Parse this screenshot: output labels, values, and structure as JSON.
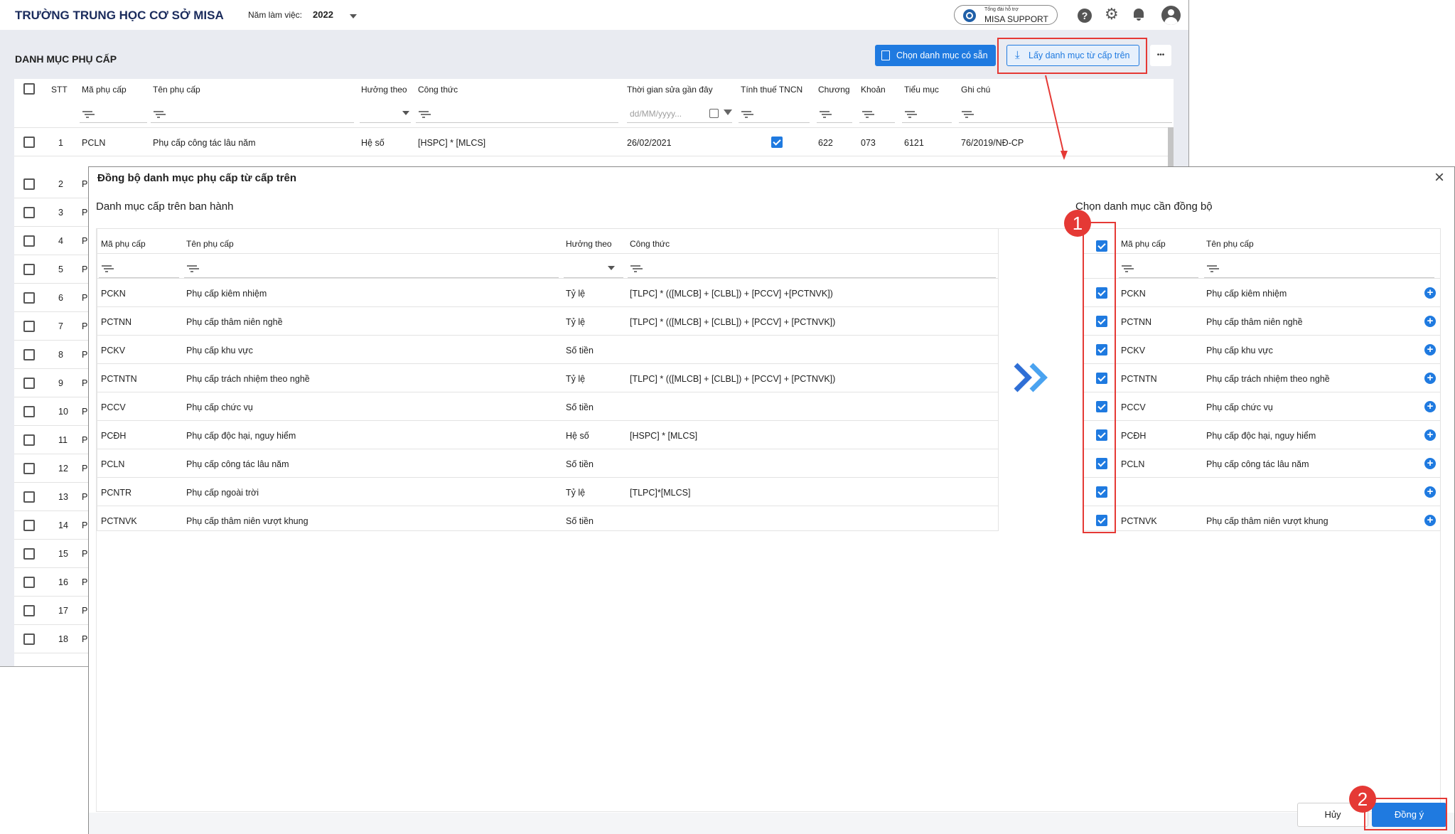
{
  "app": {
    "school_name": "TRƯỜNG TRUNG HỌC CƠ SỞ MISA",
    "year_label": "Năm làm việc:",
    "year_value": "2022",
    "support_top": "Tổng đài hỗ trợ",
    "support_label": "MISA SUPPORT"
  },
  "page": {
    "title": "DANH MỤC PHỤ CẤP",
    "btn_choose": "Chọn danh mục có sẵn",
    "btn_get": "Lấy danh mục từ cấp trên",
    "more": "•••"
  },
  "grid": {
    "headers": [
      "STT",
      "Mã phụ cấp",
      "Tên phụ cấp",
      "Hưởng theo",
      "Công thức",
      "Thời gian sửa gần đây",
      "Tính thuế TNCN",
      "Chương",
      "Khoản",
      "Tiểu mục",
      "Ghi chú"
    ],
    "date_placeholder": "dd/MM/yyyy...",
    "first_row": {
      "stt": "1",
      "code": "PCLN",
      "name": "Phụ cấp công tác lâu năm",
      "by": "Hệ số",
      "formula": "[HSPC] * [MLCS]",
      "date": "26/02/2021",
      "chuong": "622",
      "khoan": "073",
      "tieumuc": "6121",
      "note": "76/2019/NĐ-CP"
    },
    "stt_rows": [
      "2",
      "3",
      "4",
      "5",
      "6",
      "7",
      "8",
      "9",
      "10",
      "11",
      "12",
      "13",
      "14",
      "15",
      "16",
      "17",
      "18"
    ],
    "code_initial": "P"
  },
  "modal": {
    "title": "Đồng bộ danh mục phụ cấp từ cấp trên",
    "left_title": "Danh mục cấp trên ban hành",
    "right_title": "Chọn danh mục cần đồng bộ",
    "left_headers": [
      "Mã phụ cấp",
      "Tên phụ cấp",
      "Hưởng theo",
      "Công thức"
    ],
    "right_headers": [
      "Mã phụ cấp",
      "Tên phụ cấp"
    ],
    "left_rows": [
      {
        "code": "PCKN",
        "name": "Phụ cấp kiêm nhiệm",
        "by": "Tỷ lệ",
        "formula": "[TLPC] * (([MLCB] + [CLBL]) + [PCCV] +[PCTNVK])"
      },
      {
        "code": "PCTNN",
        "name": "Phụ cấp thâm niên nghề",
        "by": "Tỷ lệ",
        "formula": "[TLPC] * (([MLCB] + [CLBL]) + [PCCV] + [PCTNVK])"
      },
      {
        "code": "PCKV",
        "name": "Phụ cấp khu vực",
        "by": "Số tiền",
        "formula": ""
      },
      {
        "code": "PCTNTN",
        "name": "Phụ cấp trách nhiệm theo nghề",
        "by": "Tỷ lệ",
        "formula": "[TLPC] * (([MLCB] + [CLBL]) + [PCCV] + [PCTNVK])"
      },
      {
        "code": "PCCV",
        "name": "Phụ cấp chức vụ",
        "by": "Số tiền",
        "formula": ""
      },
      {
        "code": "PCĐH",
        "name": "Phụ cấp độc hại, nguy hiểm",
        "by": "Hệ số",
        "formula": "[HSPC] * [MLCS]"
      },
      {
        "code": "PCLN",
        "name": "Phụ cấp công tác lâu năm",
        "by": "Số tiền",
        "formula": ""
      },
      {
        "code": "PCNTR",
        "name": "Phụ cấp ngoài trời",
        "by": "Tỷ lệ",
        "formula": "[TLPC]*[MLCS]"
      },
      {
        "code": "PCTNVK",
        "name": "Phụ cấp thâm niên vượt khung",
        "by": "Số tiền",
        "formula": ""
      }
    ],
    "right_rows": [
      {
        "code": "PCKN",
        "name": "Phụ cấp kiêm nhiệm"
      },
      {
        "code": "PCTNN",
        "name": "Phụ cấp thâm niên nghề"
      },
      {
        "code": "PCKV",
        "name": "Phụ cấp khu vực"
      },
      {
        "code": "PCTNTN",
        "name": "Phụ cấp trách nhiệm theo nghề"
      },
      {
        "code": "PCCV",
        "name": "Phụ cấp chức vụ"
      },
      {
        "code": "PCĐH",
        "name": "Phụ cấp độc hại, nguy hiểm"
      },
      {
        "code": "PCLN",
        "name": "Phụ cấp công tác lâu năm"
      },
      {
        "code": "",
        "name": ""
      },
      {
        "code": "PCTNVK",
        "name": "Phụ cấp thâm niên vượt khung"
      }
    ],
    "btn_cancel": "Hủy",
    "btn_ok": "Đồng ý"
  },
  "annotations": {
    "badge1": "1",
    "badge2": "2"
  },
  "colors": {
    "primary": "#1f7ae0",
    "annotation": "#e53935"
  }
}
